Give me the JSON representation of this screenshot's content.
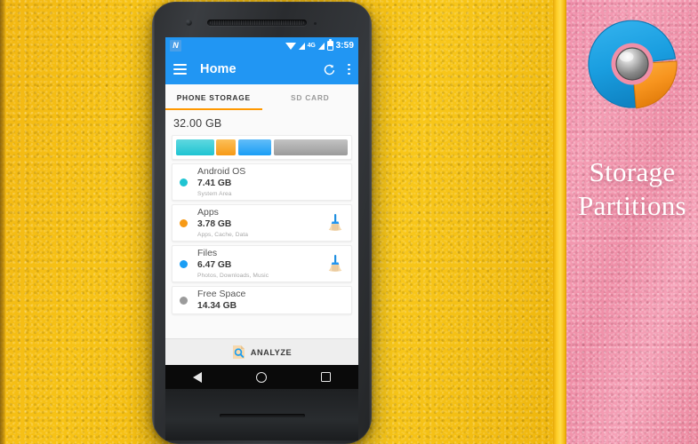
{
  "scene": {
    "left_wall_color": "#f3bb0e",
    "divider_stripe_color": "#ffd02a",
    "right_wall_color": "#ef8fa8"
  },
  "phone": {
    "status_bar": {
      "notification_icon": "n-notification-icon",
      "notification_letter": "N",
      "wifi_icon": "wifi-icon",
      "signal_icon": "signal-bars-icon",
      "network_type": "4G",
      "signal_icon_2": "signal-bars-icon",
      "battery_icon": "battery-icon",
      "time": "3:59"
    },
    "app_bar": {
      "menu_icon": "hamburger-menu-icon",
      "title": "Home",
      "refresh_icon": "refresh-icon",
      "overflow_icon": "overflow-menu-icon"
    },
    "tabs": [
      {
        "label": "PHONE STORAGE",
        "active": true
      },
      {
        "label": "SD CARD",
        "active": false
      }
    ],
    "total_size": "32.00 GB",
    "storage_bar": {
      "segments": [
        {
          "name": "Android OS",
          "color": "#1fc4d2",
          "gb": 7.41
        },
        {
          "name": "Apps",
          "color": "#f79a16",
          "gb": 3.78
        },
        {
          "name": "Files",
          "color": "#1a9ef5",
          "gb": 6.47
        },
        {
          "name": "Free Space",
          "color": "#9b9b9b",
          "gb": 14.34
        }
      ]
    },
    "rows": [
      {
        "title": "Android OS",
        "size": "7.41 GB",
        "subtitle": "System Area",
        "dot_color": "#1fc4d2",
        "has_clean": false
      },
      {
        "title": "Apps",
        "size": "3.78 GB",
        "subtitle": "Apps, Cache, Data",
        "dot_color": "#f79a16",
        "has_clean": true
      },
      {
        "title": "Files",
        "size": "6.47 GB",
        "subtitle": "Photos, Downloads, Music",
        "dot_color": "#1a9ef5",
        "has_clean": true
      },
      {
        "title": "Free Space",
        "size": "14.34 GB",
        "subtitle": "",
        "dot_color": "#9b9b9b",
        "has_clean": false
      }
    ],
    "analyze": {
      "icon": "analyze-magnifier-document-icon",
      "label": "ANALYZE"
    },
    "nav_bar": {
      "back_icon": "nav-back-icon",
      "home_icon": "nav-home-icon",
      "recents_icon": "nav-recents-icon"
    }
  },
  "branding": {
    "logo_icon": "storage-partitions-donut-logo",
    "logo_blue": "#1a9ee0",
    "logo_orange": "#f7941e",
    "title_line1": "Storage",
    "title_line2": "Partitions"
  }
}
